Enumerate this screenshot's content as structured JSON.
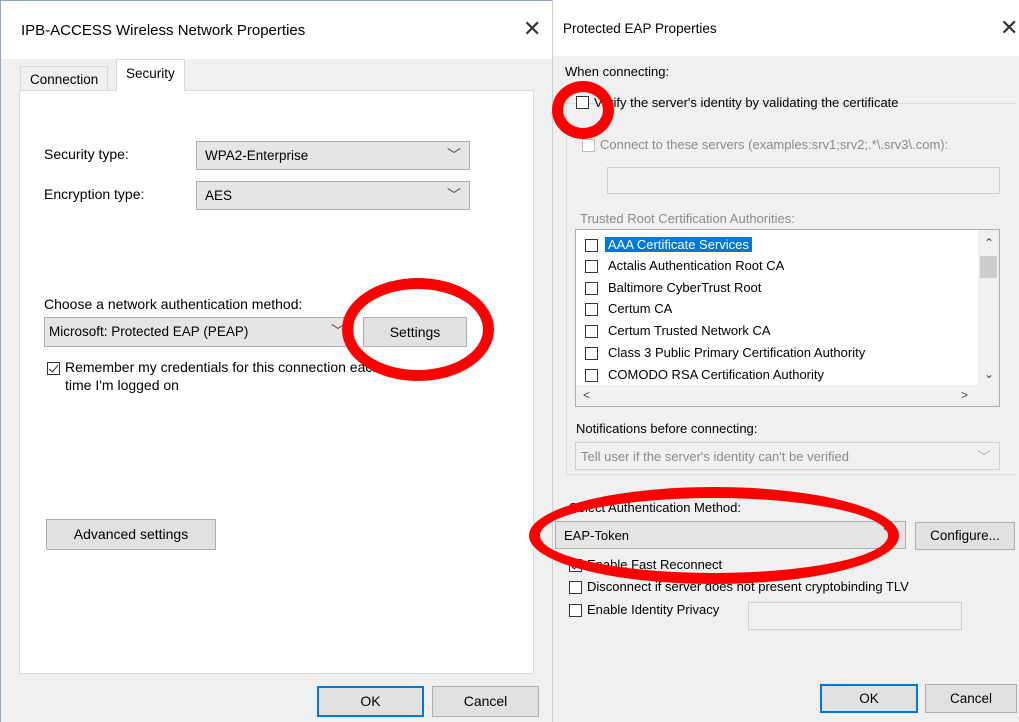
{
  "left_dialog": {
    "title": "IPB-ACCESS Wireless Network Properties",
    "tabs": [
      {
        "label": "Connection"
      },
      {
        "label": "Security"
      }
    ],
    "security_type_label": "Security type:",
    "security_type_value": "WPA2-Enterprise",
    "encryption_type_label": "Encryption type:",
    "encryption_type_value": "AES",
    "auth_method_label": "Choose a network authentication method:",
    "auth_method_value": "Microsoft: Protected EAP (PEAP)",
    "settings_button": "Settings",
    "remember_line1": "Remember my credentials for this connection each",
    "remember_line2": "time I'm logged on",
    "advanced_button": "Advanced settings",
    "ok_button": "OK",
    "cancel_button": "Cancel"
  },
  "right_dialog": {
    "title": "Protected EAP Properties",
    "when_connecting": "When connecting:",
    "verify_label": "Verify the server's identity by validating the certificate",
    "connect_servers_label": "Connect to these servers (examples:srv1;srv2;.*\\.srv3\\.com):",
    "trusted_root_label": "Trusted Root Certification Authorities:",
    "cert_authorities": [
      {
        "name": "AAA Certificate Services",
        "selected": true
      },
      {
        "name": "Actalis Authentication Root CA",
        "selected": false
      },
      {
        "name": "Baltimore CyberTrust Root",
        "selected": false
      },
      {
        "name": "Certum CA",
        "selected": false
      },
      {
        "name": "Certum Trusted Network CA",
        "selected": false
      },
      {
        "name": "Class 3 Public Primary Certification Authority",
        "selected": false
      },
      {
        "name": "COMODO RSA Certification Authority",
        "selected": false
      }
    ],
    "notifications_label": "Notifications before connecting:",
    "notifications_value": "Tell user if the server's identity can't be verified",
    "auth_method_label": "Select Authentication Method:",
    "auth_method_value": "EAP-Token",
    "configure_button": "Configure...",
    "fast_reconnect_label": "Enable Fast Reconnect",
    "disconnect_label": "Disconnect if server does not present cryptobinding TLV",
    "identity_privacy_label": "Enable Identity Privacy",
    "ok_button": "OK",
    "cancel_button": "Cancel"
  },
  "icons": {
    "close": "close-icon",
    "chevron": "chevron-down-icon",
    "annotation": "red-circle-annotation"
  },
  "colors": {
    "annotation": "#ff0000",
    "selection": "#0078d7",
    "default_button_border": "#0078d7"
  }
}
